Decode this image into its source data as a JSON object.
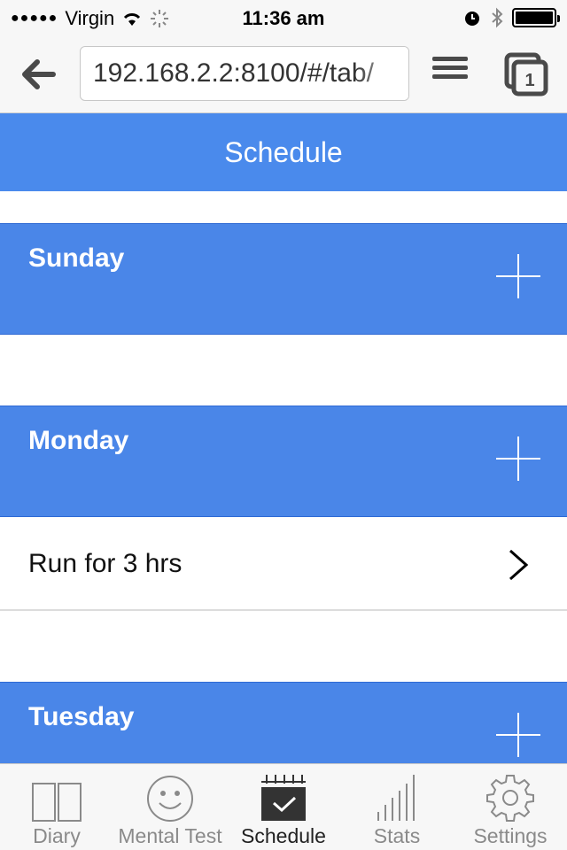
{
  "status": {
    "carrier": "Virgin",
    "signal_dots": "●●●●●",
    "time": "11:36 am"
  },
  "browser": {
    "url": "192.168.2.2:8100/#/tab/",
    "tab_count": "1"
  },
  "header": {
    "title": "Schedule"
  },
  "days": [
    {
      "name": "Sunday"
    },
    {
      "name": "Monday",
      "items": [
        {
          "label": "Run for 3 hrs"
        }
      ]
    },
    {
      "name": "Tuesday"
    }
  ],
  "tabbar": {
    "tabs": [
      {
        "label": "Diary"
      },
      {
        "label": "Mental Test"
      },
      {
        "label": "Schedule"
      },
      {
        "label": "Stats"
      },
      {
        "label": "Settings"
      }
    ]
  },
  "colors": {
    "accent": "#4a8aec",
    "bar_bg": "#f7f7f7"
  }
}
